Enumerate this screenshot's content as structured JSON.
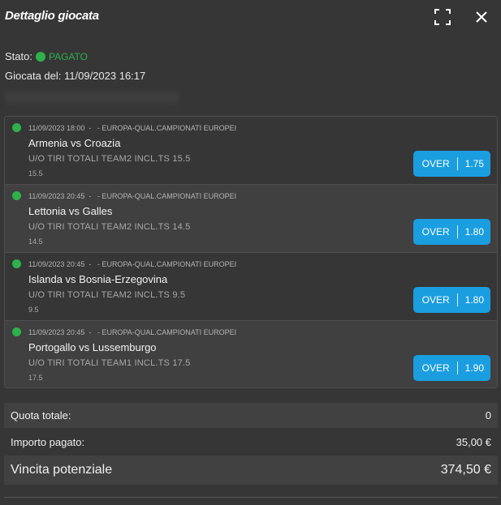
{
  "header": {
    "title": "Dettaglio giocata",
    "expand_icon": "fullscreen-icon",
    "close_icon": "close-icon"
  },
  "status": {
    "label": "Stato:",
    "value": "PAGATO",
    "color": "#2db24a"
  },
  "giocata": {
    "label": "Giocata del:",
    "datetime": "11/09/2023 16:17"
  },
  "events": [
    {
      "datetime": "11/09/2023 18:00",
      "separator": "-",
      "competition": "- EUROPA-QUAL.CAMPIONATI EUROPEI",
      "match": "Armenia vs Croazia",
      "market": "U/O TIRI TOTALI TEAM2 INCL.TS 15.5",
      "line": "15.5",
      "selection": "OVER",
      "odd": "1.75"
    },
    {
      "datetime": "11/09/2023 20:45",
      "separator": "-",
      "competition": "- EUROPA-QUAL.CAMPIONATI EUROPEI",
      "match": "Lettonia vs Galles",
      "market": "U/O TIRI TOTALI TEAM2 INCL.TS 14.5",
      "line": "14.5",
      "selection": "OVER",
      "odd": "1.80"
    },
    {
      "datetime": "11/09/2023 20:45",
      "separator": "-",
      "competition": "- EUROPA-QUAL.CAMPIONATI EUROPEI",
      "match": "Islanda vs Bosnia-Erzegovina",
      "market": "U/O TIRI TOTALI TEAM2 INCL.TS 9.5",
      "line": "9.5",
      "selection": "OVER",
      "odd": "1.80"
    },
    {
      "datetime": "11/09/2023 20:45",
      "separator": "-",
      "competition": "- EUROPA-QUAL.CAMPIONATI EUROPEI",
      "match": "Portogallo vs Lussemburgo",
      "market": "U/O TIRI TOTALI TEAM1 INCL.TS 17.5",
      "line": "17.5",
      "selection": "OVER",
      "odd": "1.90"
    }
  ],
  "summary": {
    "quota_label": "Quota totale:",
    "quota_value": "0",
    "importo_label": "Importo pagato:",
    "importo_value": "35,00 €",
    "vincita_label": "Vincita potenziale",
    "vincita_value": "374,50 €"
  },
  "colors": {
    "background": "#363636",
    "accent": "#1a9ee0",
    "status_green": "#2db24a"
  }
}
